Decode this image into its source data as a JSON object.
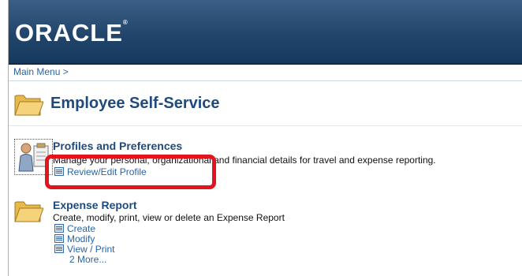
{
  "header": {
    "brand": "ORACLE",
    "trademark": "®"
  },
  "breadcrumb": {
    "main_menu": "Main Menu >"
  },
  "page": {
    "title": "Employee Self-Service"
  },
  "sections": [
    {
      "title": "Profiles and Preferences",
      "description": "Manage your personal, organizational and financial details for travel and expense reporting.",
      "links": [
        "Review/Edit Profile"
      ]
    },
    {
      "title": "Expense Report",
      "description": "Create, modify, print, view or delete an Expense Report",
      "links": [
        "Create",
        "Modify",
        "View / Print"
      ],
      "more": "2 More..."
    }
  ],
  "colors": {
    "header_bg": "#22466b",
    "title_blue": "#1f4a7d",
    "link_blue": "#2a64a8",
    "highlight_red": "#e0151d"
  }
}
